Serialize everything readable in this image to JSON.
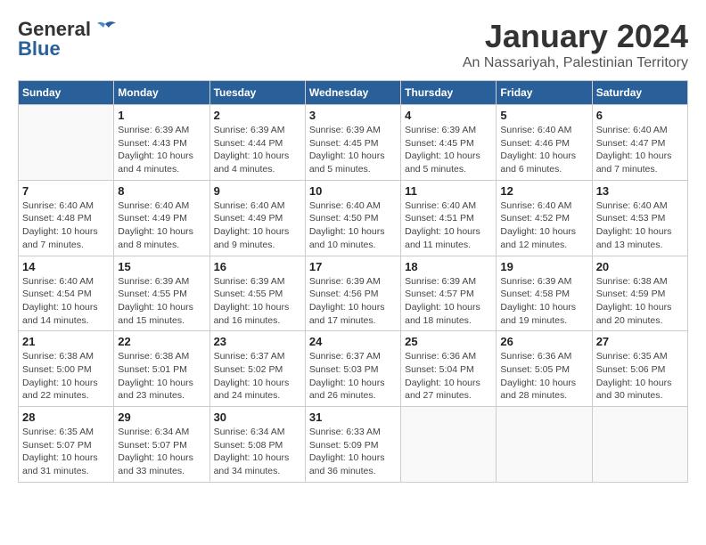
{
  "logo": {
    "general": "General",
    "blue": "Blue"
  },
  "title": "January 2024",
  "location": "An Nassariyah, Palestinian Territory",
  "days_of_week": [
    "Sunday",
    "Monday",
    "Tuesday",
    "Wednesday",
    "Thursday",
    "Friday",
    "Saturday"
  ],
  "weeks": [
    [
      {
        "day": "",
        "info": ""
      },
      {
        "day": "1",
        "info": "Sunrise: 6:39 AM\nSunset: 4:43 PM\nDaylight: 10 hours\nand 4 minutes."
      },
      {
        "day": "2",
        "info": "Sunrise: 6:39 AM\nSunset: 4:44 PM\nDaylight: 10 hours\nand 4 minutes."
      },
      {
        "day": "3",
        "info": "Sunrise: 6:39 AM\nSunset: 4:45 PM\nDaylight: 10 hours\nand 5 minutes."
      },
      {
        "day": "4",
        "info": "Sunrise: 6:39 AM\nSunset: 4:45 PM\nDaylight: 10 hours\nand 5 minutes."
      },
      {
        "day": "5",
        "info": "Sunrise: 6:40 AM\nSunset: 4:46 PM\nDaylight: 10 hours\nand 6 minutes."
      },
      {
        "day": "6",
        "info": "Sunrise: 6:40 AM\nSunset: 4:47 PM\nDaylight: 10 hours\nand 7 minutes."
      }
    ],
    [
      {
        "day": "7",
        "info": "Sunrise: 6:40 AM\nSunset: 4:48 PM\nDaylight: 10 hours\nand 7 minutes."
      },
      {
        "day": "8",
        "info": "Sunrise: 6:40 AM\nSunset: 4:49 PM\nDaylight: 10 hours\nand 8 minutes."
      },
      {
        "day": "9",
        "info": "Sunrise: 6:40 AM\nSunset: 4:49 PM\nDaylight: 10 hours\nand 9 minutes."
      },
      {
        "day": "10",
        "info": "Sunrise: 6:40 AM\nSunset: 4:50 PM\nDaylight: 10 hours\nand 10 minutes."
      },
      {
        "day": "11",
        "info": "Sunrise: 6:40 AM\nSunset: 4:51 PM\nDaylight: 10 hours\nand 11 minutes."
      },
      {
        "day": "12",
        "info": "Sunrise: 6:40 AM\nSunset: 4:52 PM\nDaylight: 10 hours\nand 12 minutes."
      },
      {
        "day": "13",
        "info": "Sunrise: 6:40 AM\nSunset: 4:53 PM\nDaylight: 10 hours\nand 13 minutes."
      }
    ],
    [
      {
        "day": "14",
        "info": "Sunrise: 6:40 AM\nSunset: 4:54 PM\nDaylight: 10 hours\nand 14 minutes."
      },
      {
        "day": "15",
        "info": "Sunrise: 6:39 AM\nSunset: 4:55 PM\nDaylight: 10 hours\nand 15 minutes."
      },
      {
        "day": "16",
        "info": "Sunrise: 6:39 AM\nSunset: 4:55 PM\nDaylight: 10 hours\nand 16 minutes."
      },
      {
        "day": "17",
        "info": "Sunrise: 6:39 AM\nSunset: 4:56 PM\nDaylight: 10 hours\nand 17 minutes."
      },
      {
        "day": "18",
        "info": "Sunrise: 6:39 AM\nSunset: 4:57 PM\nDaylight: 10 hours\nand 18 minutes."
      },
      {
        "day": "19",
        "info": "Sunrise: 6:39 AM\nSunset: 4:58 PM\nDaylight: 10 hours\nand 19 minutes."
      },
      {
        "day": "20",
        "info": "Sunrise: 6:38 AM\nSunset: 4:59 PM\nDaylight: 10 hours\nand 20 minutes."
      }
    ],
    [
      {
        "day": "21",
        "info": "Sunrise: 6:38 AM\nSunset: 5:00 PM\nDaylight: 10 hours\nand 22 minutes."
      },
      {
        "day": "22",
        "info": "Sunrise: 6:38 AM\nSunset: 5:01 PM\nDaylight: 10 hours\nand 23 minutes."
      },
      {
        "day": "23",
        "info": "Sunrise: 6:37 AM\nSunset: 5:02 PM\nDaylight: 10 hours\nand 24 minutes."
      },
      {
        "day": "24",
        "info": "Sunrise: 6:37 AM\nSunset: 5:03 PM\nDaylight: 10 hours\nand 26 minutes."
      },
      {
        "day": "25",
        "info": "Sunrise: 6:36 AM\nSunset: 5:04 PM\nDaylight: 10 hours\nand 27 minutes."
      },
      {
        "day": "26",
        "info": "Sunrise: 6:36 AM\nSunset: 5:05 PM\nDaylight: 10 hours\nand 28 minutes."
      },
      {
        "day": "27",
        "info": "Sunrise: 6:35 AM\nSunset: 5:06 PM\nDaylight: 10 hours\nand 30 minutes."
      }
    ],
    [
      {
        "day": "28",
        "info": "Sunrise: 6:35 AM\nSunset: 5:07 PM\nDaylight: 10 hours\nand 31 minutes."
      },
      {
        "day": "29",
        "info": "Sunrise: 6:34 AM\nSunset: 5:07 PM\nDaylight: 10 hours\nand 33 minutes."
      },
      {
        "day": "30",
        "info": "Sunrise: 6:34 AM\nSunset: 5:08 PM\nDaylight: 10 hours\nand 34 minutes."
      },
      {
        "day": "31",
        "info": "Sunrise: 6:33 AM\nSunset: 5:09 PM\nDaylight: 10 hours\nand 36 minutes."
      },
      {
        "day": "",
        "info": ""
      },
      {
        "day": "",
        "info": ""
      },
      {
        "day": "",
        "info": ""
      }
    ]
  ]
}
